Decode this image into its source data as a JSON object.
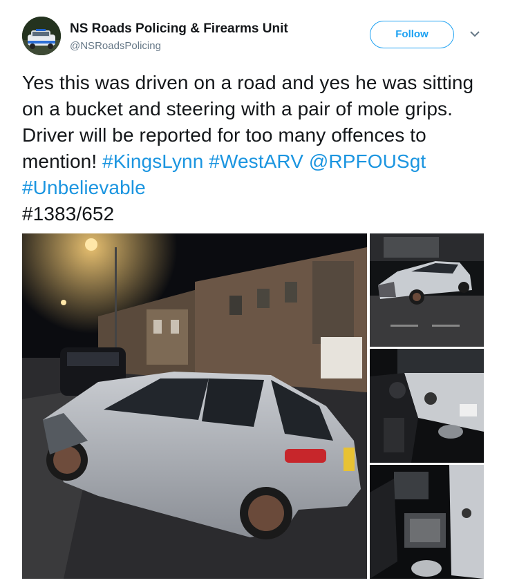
{
  "account": {
    "display_name": "NS Roads Policing & Firearms Unit",
    "handle": "@NSRoadsPolicing",
    "avatar_icon": "police-car-avatar"
  },
  "actions": {
    "follow_label": "Follow",
    "menu_icon": "chevron-down-icon"
  },
  "tweet": {
    "text": "Yes this was driven on a road and yes he was sitting on a bucket and steering with a pair of mole grips. Driver will be reported for too many offences to mention!",
    "hashtag_kingslynn": "#KingsLynn",
    "hashtag_westarv": "#WestARV",
    "mention": "@RPFOUSgt",
    "hashtag_unbelievable": "#Unbelievable",
    "reference": "#1383/652"
  },
  "colors": {
    "link": "#1b95e0",
    "follow_accent": "#1da1f2",
    "handle_gray": "#657786"
  },
  "media": {
    "photos": [
      {
        "name": "main-car-photo"
      },
      {
        "name": "car-rear-photo"
      },
      {
        "name": "door-interior-photo"
      },
      {
        "name": "footwell-photo"
      }
    ]
  }
}
